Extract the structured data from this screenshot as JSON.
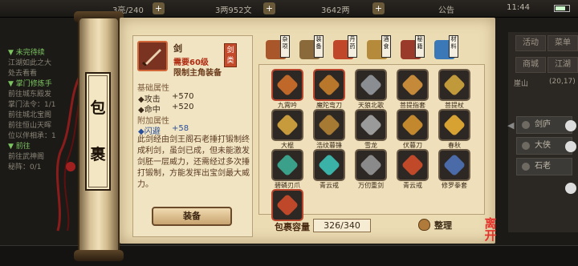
{
  "top": {
    "res1": "3亮/240",
    "res2": "3两952文",
    "res3": "3642两",
    "notice": "公告",
    "time": "11:44"
  },
  "quest": {
    "lines": [
      {
        "t": "▼ 未完待续",
        "k": "q"
      },
      {
        "t": "江湖如此之大",
        "k": "d"
      },
      {
        "t": "处去看看",
        "k": "d"
      },
      {
        "t": "▼ 掌门修炼手",
        "k": "q"
      },
      {
        "t": "前往城东殿发",
        "k": "d"
      },
      {
        "t": "掌门法令：1/1",
        "k": "d"
      },
      {
        "t": "前往城北宝阁",
        "k": "d"
      },
      {
        "t": "前往恒山天晖",
        "k": "d"
      },
      {
        "t": "位以伴相承：1",
        "k": "d"
      },
      {
        "t": "▼ 前往",
        "k": "q"
      },
      {
        "t": "前往武神阁",
        "k": "d"
      },
      {
        "t": "秘阵：0/1",
        "k": "d"
      }
    ]
  },
  "right_panel": {
    "btn1": "活动",
    "btn2": "菜单",
    "btn3": "商城",
    "btn4": "江湖",
    "loc": "崖山",
    "coords": "(20,17)",
    "list": [
      "剑庐",
      "大侠",
      "石老"
    ]
  },
  "scroll_title": [
    "包",
    "裹"
  ],
  "detail": {
    "name": "剑",
    "type_tag": "剑类",
    "req_level": "需要60级",
    "req_role": "限制主角装备",
    "base_title": "基础属性",
    "base_stats": [
      {
        "label": "◆攻击",
        "value": "+570"
      },
      {
        "label": "◆命中",
        "value": "+520"
      }
    ],
    "extra_title": "附加属性",
    "extra_stats": [
      {
        "label": "◆闪避",
        "value": "+58"
      }
    ],
    "description": "此剑经由剑王阁石老捶打锻制终成利剑，虽剑已成，但未能激发剑胚一层威力，还需经过多次捶打锻制，方能发挥出宝剑最大威力。",
    "equip_label": "装备"
  },
  "tabs": [
    {
      "label": "杂项",
      "color": "#a8562a"
    },
    {
      "label": "装备",
      "color": "#8a6a3a"
    },
    {
      "label": "丹药",
      "color": "#c0472a"
    },
    {
      "label": "酒食",
      "color": "#b58a3a"
    },
    {
      "label": "秘籍",
      "color": "#9a3a2a"
    },
    {
      "label": "材料",
      "color": "#3a78b8"
    }
  ],
  "items": [
    {
      "name": "九霄吟",
      "color": "#c0682a",
      "red": true
    },
    {
      "name": "魔陀弯刀",
      "color": "#b8772a",
      "red": true
    },
    {
      "name": "天狼北歌",
      "color": "#8a8e92",
      "red": false
    },
    {
      "name": "菩提指套",
      "color": "#c48a3a",
      "red": false
    },
    {
      "name": "菩提杖",
      "color": "#c09a3a",
      "red": false
    },
    {
      "name": "大棍",
      "color": "#c79a3c",
      "red": false
    },
    {
      "name": "浩纹暮锤",
      "color": "#a77a34",
      "red": false
    },
    {
      "name": "雪龙",
      "color": "#9a9a9a",
      "red": false
    },
    {
      "name": "伏暮刀",
      "color": "#c3882e",
      "red": false
    },
    {
      "name": "春秋",
      "color": "#d8a232",
      "red": false
    },
    {
      "name": "碧磷刃爪",
      "color": "#3aa08a",
      "red": false
    },
    {
      "name": "青云戒",
      "color": "#3ab2a8",
      "red": false
    },
    {
      "name": "万仞重剑",
      "color": "#8a8a8a",
      "red": false
    },
    {
      "name": "青云戒",
      "color": "#c0492a",
      "red": false
    },
    {
      "name": "修罗拳套",
      "color": "#4a6aa8",
      "red": false
    },
    {
      "name": "",
      "color": "#c0482a",
      "red": true
    }
  ],
  "capacity_label": "包裹容量",
  "capacity_value": "326/340",
  "sort_label": "整理",
  "close_label": "离开"
}
